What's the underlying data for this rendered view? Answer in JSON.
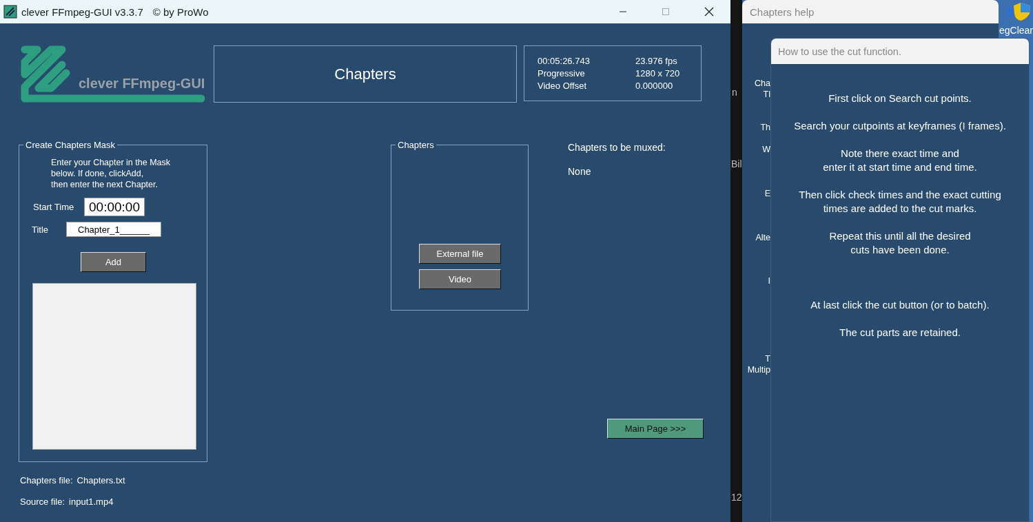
{
  "window": {
    "title": "clever FFmpeg-GUI v3.3.7",
    "copyright": "© by ProWo"
  },
  "logo": {
    "text": "clever FFmpeg-GUI"
  },
  "page_title": "Chapters",
  "video_info": [
    {
      "label": "00:05:26.743",
      "value": "23.976 fps"
    },
    {
      "label": "Progressive",
      "value": "1280 x 720"
    },
    {
      "label": "Video Offset",
      "value": "0.000000"
    }
  ],
  "mask": {
    "legend": "Create Chapters Mask",
    "instructions": "Enter your Chapter in the Mask\nbelow. If done, clickAdd,\nthen enter the next Chapter.",
    "start_time_label": "Start Time",
    "start_time": "00:00:00",
    "title_label": "Title",
    "title_value": "Chapter_1______",
    "add_button": "Add"
  },
  "chapters_group": {
    "legend": "Chapters",
    "buttons": [
      "External file",
      "Video"
    ]
  },
  "muxed": {
    "heading": "Chapters to be muxed:",
    "value": "None"
  },
  "main_page_button": "Main Page >>>",
  "footer": [
    {
      "label": "Chapters file:",
      "value": "Chapters.txt"
    },
    {
      "label": "Source file:",
      "value": "input1.mp4"
    }
  ],
  "desktop": {
    "strip_texts": [
      "n",
      "Bil",
      "12"
    ],
    "icon_label": "egClear"
  },
  "help_window": {
    "title": "Chapters help",
    "background_labels": [
      "Cha",
      "Tl",
      "Th",
      "W",
      "E",
      "Alte",
      "I",
      "T",
      "Multip"
    ]
  },
  "cut_help_window": {
    "title": "How to use the cut function.",
    "text": "First click on Search cut points.\n\nSearch your cutpoints at keyframes (I frames).\n\nNote there exact time and\nenter it at start time and end time.\n\nThen click check times and the exact cutting\ntimes are added to the cut marks.\n\nRepeat this until all the desired\ncuts have been done.\n\n\n\nAt last click the cut button (or to batch).\n\nThe cut parts are retained."
  }
}
